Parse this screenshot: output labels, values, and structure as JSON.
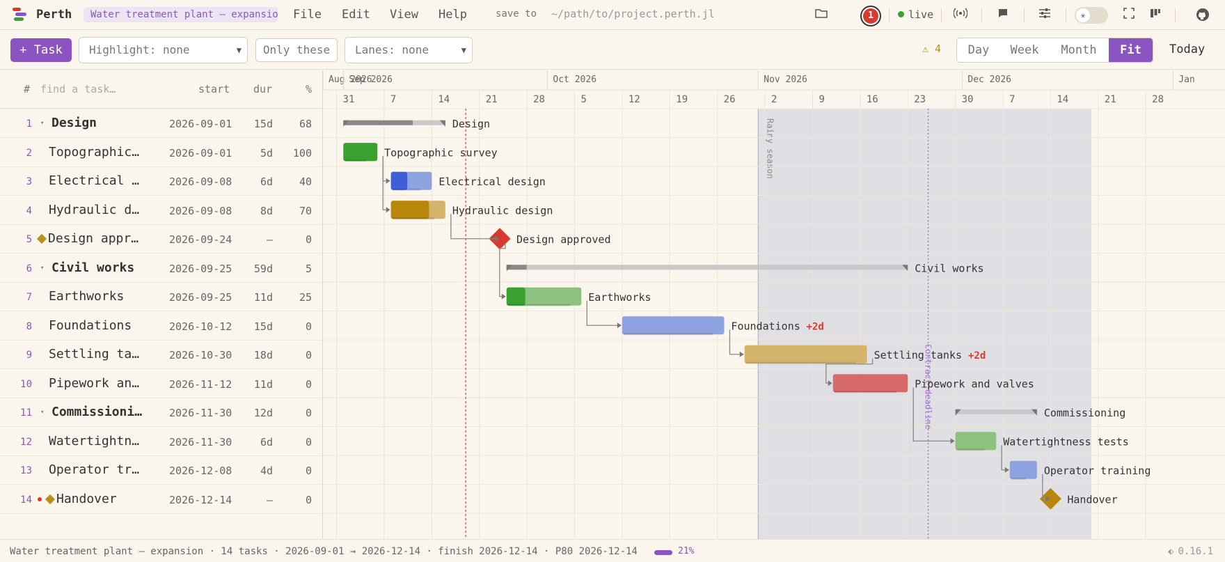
{
  "app": {
    "name": "Perth",
    "project_title": "Water treatment plant — expansion"
  },
  "menu": [
    "File",
    "Edit",
    "View",
    "Help"
  ],
  "save": {
    "label": "save to",
    "path": "~/path/to/project.perth.jl"
  },
  "topbar": {
    "notification_count": "1",
    "live_label": "live",
    "theme_icon": "sun-icon"
  },
  "toolbar": {
    "add_task": "+ Task",
    "highlight": "Highlight: none",
    "only_these": "Only these",
    "lanes": "Lanes: none",
    "warning_count": "⚠ 4",
    "views": [
      "Day",
      "Week",
      "Month",
      "Fit"
    ],
    "active_view": "Fit",
    "today": "Today"
  },
  "table": {
    "headers": {
      "num": "#",
      "search_placeholder": "find a task…",
      "start": "start",
      "dur": "dur",
      "pct": "%"
    },
    "rows": [
      {
        "num": "1",
        "name": "Design",
        "start": "2026-09-01",
        "dur": "15d",
        "pct": "68",
        "summary": true
      },
      {
        "num": "2",
        "name": "Topographic survey",
        "start": "2026-09-01",
        "dur": "5d",
        "pct": "100"
      },
      {
        "num": "3",
        "name": "Electrical design",
        "start": "2026-09-08",
        "dur": "6d",
        "pct": "40"
      },
      {
        "num": "4",
        "name": "Hydraulic design",
        "start": "2026-09-08",
        "dur": "8d",
        "pct": "70"
      },
      {
        "num": "5",
        "name": "Design approved",
        "start": "2026-09-24",
        "dur": "—",
        "pct": "0",
        "milestone": true
      },
      {
        "num": "6",
        "name": "Civil works",
        "start": "2026-09-25",
        "dur": "59d",
        "pct": "5",
        "summary": true
      },
      {
        "num": "7",
        "name": "Earthworks",
        "start": "2026-09-25",
        "dur": "11d",
        "pct": "25"
      },
      {
        "num": "8",
        "name": "Foundations",
        "start": "2026-10-12",
        "dur": "15d",
        "pct": "0"
      },
      {
        "num": "9",
        "name": "Settling tanks",
        "start": "2026-10-30",
        "dur": "18d",
        "pct": "0"
      },
      {
        "num": "10",
        "name": "Pipework and valves",
        "start": "2026-11-12",
        "dur": "11d",
        "pct": "0"
      },
      {
        "num": "11",
        "name": "Commissioning",
        "start": "2026-11-30",
        "dur": "12d",
        "pct": "0",
        "summary": true
      },
      {
        "num": "12",
        "name": "Watertightness tests",
        "start": "2026-11-30",
        "dur": "6d",
        "pct": "0"
      },
      {
        "num": "13",
        "name": "Operator training",
        "start": "2026-12-08",
        "dur": "4d",
        "pct": "0"
      },
      {
        "num": "14",
        "name": "Handover",
        "start": "2026-12-14",
        "dur": "—",
        "pct": "0",
        "milestone": true,
        "flag": true
      }
    ]
  },
  "timeline": {
    "months": [
      {
        "label": "Aug 2026",
        "date": "2026-08-29"
      },
      {
        "label": "Sep 2026",
        "date": "2026-09-01"
      },
      {
        "label": "Oct 2026",
        "date": "2026-10-01"
      },
      {
        "label": "Nov 2026",
        "date": "2026-11-01"
      },
      {
        "label": "Dec 2026",
        "date": "2026-12-01"
      },
      {
        "label": "Jan",
        "date": "2027-01-01"
      }
    ],
    "weeks": [
      "31",
      "7",
      "14",
      "21",
      "28",
      "5",
      "12",
      "19",
      "26",
      "2",
      "9",
      "16",
      "23",
      "30",
      "7",
      "14",
      "21",
      "28"
    ],
    "shade": {
      "label": "Rainy season",
      "from": "2026-11-01",
      "to": "2026-12-20"
    },
    "today_date": "2026-09-19",
    "deadline": {
      "label": "Contract deadline",
      "date": "2026-11-26"
    },
    "slip_label": "+2d"
  },
  "colors": {
    "accent": "#8c54c1",
    "green": "#3aa02f",
    "green_light": "#8dc17f",
    "blue": "#3f5fd6",
    "blue_light": "#8ea2e0",
    "gold": "#b8860b",
    "gold_light": "#d4b46a",
    "red": "#d66a6a",
    "milestone_red": "#d63b2f",
    "summary": "#c8c8c8"
  },
  "status": {
    "text": "Water treatment plant — expansion · 14 tasks · 2026-09-01 → 2026-12-14 · finish 2026-12-14 · P80 2026-12-14",
    "progress": 0.21,
    "progress_label": "21%",
    "version": "0.16.1"
  }
}
